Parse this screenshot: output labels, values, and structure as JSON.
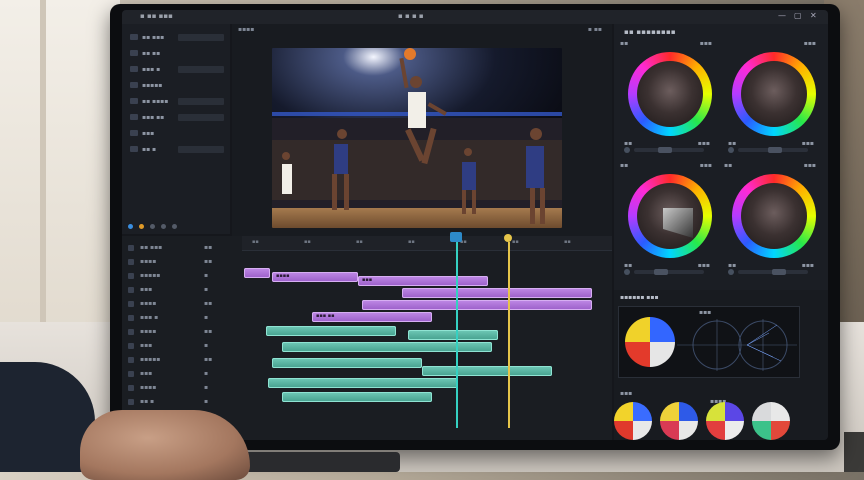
{
  "app": {
    "title": "▪ ▪ ▪ ▪",
    "left_title": "▪ ▪▪ ▪▪▪",
    "window_buttons": [
      "—",
      "▢",
      "✕"
    ]
  },
  "media_panel": {
    "items": [
      {
        "label": "▪▪ ▪▪▪"
      },
      {
        "label": "▪▪ ▪▪"
      },
      {
        "label": "▪▪▪ ▪"
      },
      {
        "label": "▪▪▪▪▪"
      },
      {
        "label": "▪▪ ▪▪▪▪"
      },
      {
        "label": "▪▪▪ ▪▪"
      },
      {
        "label": "▪▪▪"
      },
      {
        "label": "▪▪ ▪"
      }
    ]
  },
  "viewer": {
    "label_left": "▪▪▪▪",
    "label_right": "▪ ▪▪",
    "timecode": "▪▪▪▪"
  },
  "color_panel": {
    "title": "▪▪ ▪▪▪▪▪▪▪▪",
    "wheels": [
      {
        "head": "▪▪",
        "head_right": "▪▪▪",
        "label": "▪▪",
        "value": "▪▪▪"
      },
      {
        "head": "",
        "head_right": "▪▪▪",
        "label": "▪▪",
        "value": "▪▪▪"
      },
      {
        "head": "▪▪",
        "head_right": "▪▪▪",
        "label": "▪▪",
        "value": "▪▪▪"
      },
      {
        "head": "▪▪",
        "head_right": "▪▪▪",
        "label": "▪▪",
        "value": "▪▪▪"
      }
    ]
  },
  "scopes": {
    "title": "▪▪▪▪▪▪ ▪▪▪",
    "wave_label": "▪▪▪",
    "swatches_label": "▪▪▪",
    "swatches_label2": "▪▪▪▪"
  },
  "timeline": {
    "track_headers": [
      {
        "name": "▪▪ ▪▪▪",
        "val": "▪▪"
      },
      {
        "name": "▪▪▪▪",
        "val": "▪▪"
      },
      {
        "name": "▪▪▪▪▪",
        "val": "▪"
      },
      {
        "name": "▪▪▪",
        "val": "▪"
      },
      {
        "name": "▪▪▪▪",
        "val": "▪▪"
      },
      {
        "name": "▪▪▪ ▪",
        "val": "▪"
      },
      {
        "name": "▪▪▪▪",
        "val": "▪▪"
      },
      {
        "name": "▪▪▪",
        "val": "▪"
      },
      {
        "name": "▪▪▪▪▪",
        "val": "▪▪"
      },
      {
        "name": "▪▪▪",
        "val": "▪"
      },
      {
        "name": "▪▪▪▪",
        "val": "▪"
      },
      {
        "name": "▪▪ ▪",
        "val": "▪"
      }
    ],
    "ruler": [
      "▪▪",
      "▪▪",
      "▪▪",
      "▪▪",
      "▪▪",
      "▪▪",
      "▪▪"
    ],
    "clip_labels": [
      "▪▪▪▪",
      "▪▪▪",
      "▪▪▪ ▪▪"
    ]
  },
  "colors": {
    "accent_blue": "#2d8ac9",
    "clip_purple": "#b57ce0",
    "clip_teal": "#5fbfad",
    "playhead_gold": "#e6c54a",
    "playhead_teal": "#35d1c2"
  }
}
